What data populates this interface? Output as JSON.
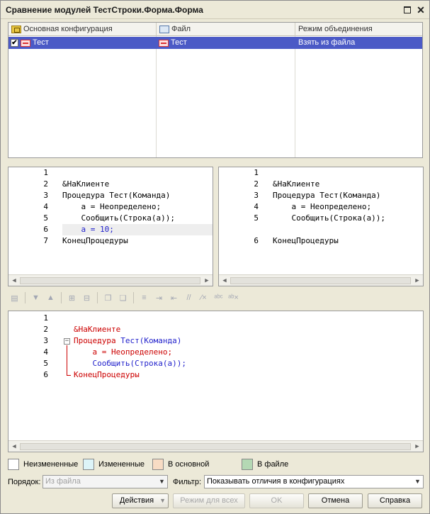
{
  "window": {
    "title": "Сравнение модулей ТестСтроки.Форма.Форма"
  },
  "grid": {
    "headers": [
      "Основная конфигурация",
      "Файл",
      "Режим объединения"
    ],
    "rows": [
      {
        "main": "Тест",
        "file": "Тест",
        "mode": "Взять из файла",
        "checked": true
      }
    ]
  },
  "left_pane": {
    "lines": [
      {
        "n": "1",
        "text": ""
      },
      {
        "n": "2",
        "text": "&НаКлиенте"
      },
      {
        "n": "3",
        "text": "Процедура Тест(Команда)"
      },
      {
        "n": "4",
        "text": "    а = Неопределено;"
      },
      {
        "n": "5",
        "text": "    Сообщить(Строка(а));"
      },
      {
        "n": "6",
        "text": "    а = 10;"
      },
      {
        "n": "7",
        "text": "КонецПроцедуры"
      }
    ]
  },
  "right_pane": {
    "lines": [
      {
        "n": "1",
        "text": ""
      },
      {
        "n": "2",
        "text": "&НаКлиенте"
      },
      {
        "n": "3",
        "text": "Процедура Тест(Команда)"
      },
      {
        "n": "4",
        "text": "    а = Неопределено;"
      },
      {
        "n": "5",
        "text": "    Сообщить(Строка(а));"
      },
      {
        "n": "",
        "text": ""
      },
      {
        "n": "6",
        "text": "КонецПроцедуры"
      }
    ]
  },
  "bottom_pane": {
    "lines": [
      {
        "n": "1"
      },
      {
        "n": "2",
        "a": "&НаКлиенте"
      },
      {
        "n": "3",
        "a": "Процедура ",
        "b": "Тест(Команда)"
      },
      {
        "n": "4",
        "a": "    а = Неопределено;"
      },
      {
        "n": "5",
        "a": "    Сообщить(Строка(а));"
      },
      {
        "n": "6",
        "a": "КонецПроцедуры"
      }
    ]
  },
  "legend": [
    {
      "label": "Неизмененные",
      "color": "#FFFFFF"
    },
    {
      "label": "Измененные",
      "color": "#DDF4F8"
    },
    {
      "label": "В основной",
      "color": "#F8DCC4"
    },
    {
      "label": "В файле",
      "color": "#B4D8B4"
    }
  ],
  "filters": {
    "order_label": "Порядок:",
    "order_value": "Из файла",
    "filter_label": "Фильтр:",
    "filter_value": "Показывать отличия в конфигурациях"
  },
  "buttons": {
    "actions": "Действия",
    "mode_all": "Режим для всех",
    "ok": "OK",
    "cancel": "Отмена",
    "help": "Справка"
  },
  "colors": {
    "selection": "#4B5AC6",
    "keyword_red": "#CC0000",
    "keyword_blue": "#2222CC",
    "changed_line": "#EEEEEE"
  }
}
